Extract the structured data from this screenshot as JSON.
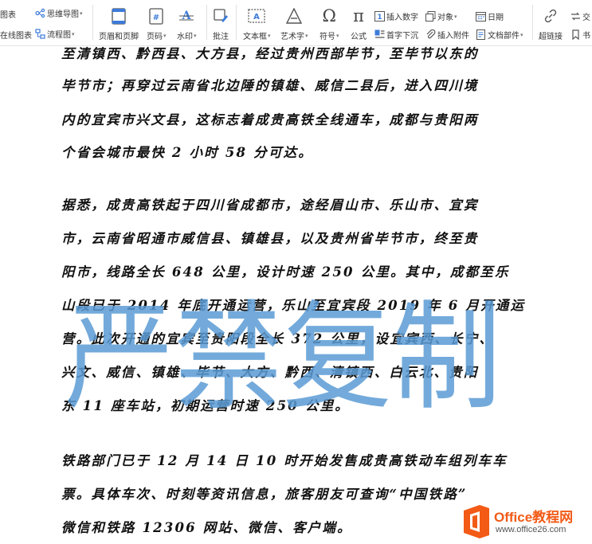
{
  "ribbon": {
    "top_row": {
      "chart_partial": "图表",
      "mindmap": "思维导图",
      "insert_number": "插入数字",
      "object": "对象",
      "date": "日期",
      "exchange_partial": "交"
    },
    "bottom_row": {
      "online_chart": "在线图表",
      "flowchart": "流程图",
      "wrap_text": "首字下沉",
      "attachment": "插入附件",
      "doc_parts": "文档部件",
      "hyperlink": "超链接",
      "bookmark_partial": "书"
    },
    "big_buttons": {
      "header_footer": "页眉和页脚",
      "page_number": "页码",
      "watermark": "水印",
      "comment": "批注",
      "textbox": "文本框",
      "wordart": "艺术字",
      "symbol": "符号",
      "formula": "公式"
    },
    "icons": [
      "chart-icon",
      "mindmap-icon",
      "online-chart-icon",
      "flowchart-icon",
      "header-footer-icon",
      "page-number-icon",
      "watermark-icon",
      "comment-icon",
      "textbox-icon",
      "wordart-icon",
      "symbol-icon",
      "formula-icon",
      "insert-number-icon",
      "object-icon",
      "date-icon",
      "drop-cap-icon",
      "attachment-icon",
      "doc-parts-icon",
      "hyperlink-icon",
      "exchange-icon",
      "bookmark-icon"
    ]
  },
  "document": {
    "lines": [
      "至清镇西、黔西县、大方县，经过贵州西部毕节，至毕节以东的",
      "毕节市；再穿过云南省北边陲的镇雄、威信二县后，进入四川境",
      "内的宜宾市兴文县，这标志着成贵高铁全线通车，成都与贵阳两",
      "个省会城市最快 2 小时 58 分可达。",
      "",
      "据悉，成贵高铁起于四川省成都市，途经眉山市、乐山市、宜宾",
      "市，云南省昭通市威信县、镇雄县，以及贵州省毕节市，终至贵",
      "阳市，线路全长 648 公里，设计时速 250 公里。其中，成都至乐",
      "山段已于 2014 年底开通运营，乐山至宜宾段 2019 年 6 月开通运",
      "营。此次开通的宜宾至贵阳段全长 372 公里，设宜宾西、长宁、",
      "兴文、威信、镇雄、毕节、大方、黔西、清镇西、白云北、贵阳",
      "东 11 座车站，初期运营时速 250 公里。",
      "",
      "铁路部门已于 12 月 14 日 10 时开始发售成贵高铁动车组列车车",
      "票。具体车次、时刻等资讯信息，旅客朋友可查询“中国铁路”",
      "微信和铁路 12306 网站、微信、客户端。"
    ]
  },
  "watermark": {
    "text": "严禁复制",
    "color": "#5b9bd5"
  },
  "logo": {
    "title": "Office教程网",
    "url": "www.office26.com",
    "color": "#f25a16"
  }
}
